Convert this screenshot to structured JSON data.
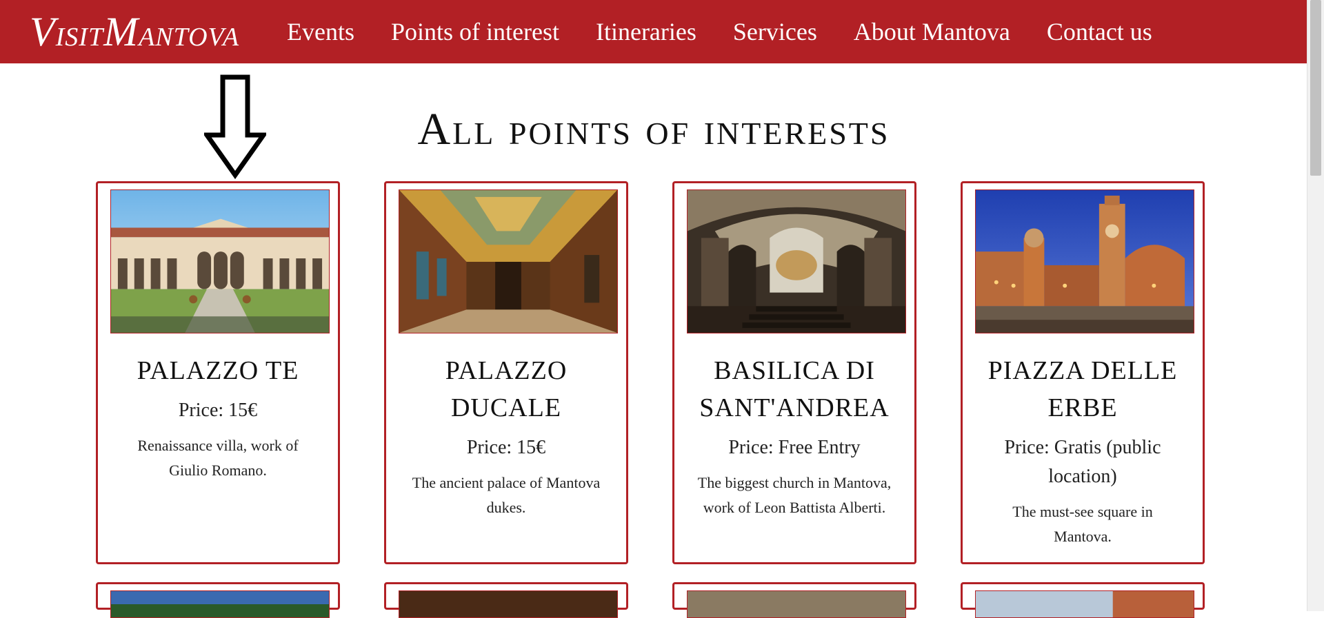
{
  "header": {
    "logo": {
      "part1_big": "V",
      "part1_small": "ISIT",
      "part2_big": "M",
      "part2_small": "ANTOVA"
    },
    "nav": [
      {
        "label": "Events"
      },
      {
        "label": "Points of interest"
      },
      {
        "label": "Itineraries"
      },
      {
        "label": "Services"
      },
      {
        "label": "About Mantova"
      },
      {
        "label": "Contact us"
      }
    ]
  },
  "main": {
    "title": "All points of interests",
    "cards": [
      {
        "name": "PALAZZO TE",
        "price": "Price: 15€",
        "description": "Renaissance villa, work of Giulio Romano.",
        "image": "palazzo-te-photo"
      },
      {
        "name": "PALAZZO DUCALE",
        "price": "Price: 15€",
        "description": "The ancient palace of Mantova dukes.",
        "image": "palazzo-ducale-photo"
      },
      {
        "name": "BASILICA DI SANT'ANDREA",
        "price": "Price: Free Entry",
        "description": "The biggest church in Mantova, work of Leon Battista Alberti.",
        "image": "basilica-photo"
      },
      {
        "name": "PIAZZA DELLE ERBE",
        "price": "Price: Gratis (public location)",
        "description": "The must-see square in Mantova.",
        "image": "piazza-photo"
      }
    ]
  },
  "colors": {
    "brand_red": "#b22025",
    "background": "#ffffff"
  },
  "icons": {
    "annotation": "down-arrow-icon"
  }
}
